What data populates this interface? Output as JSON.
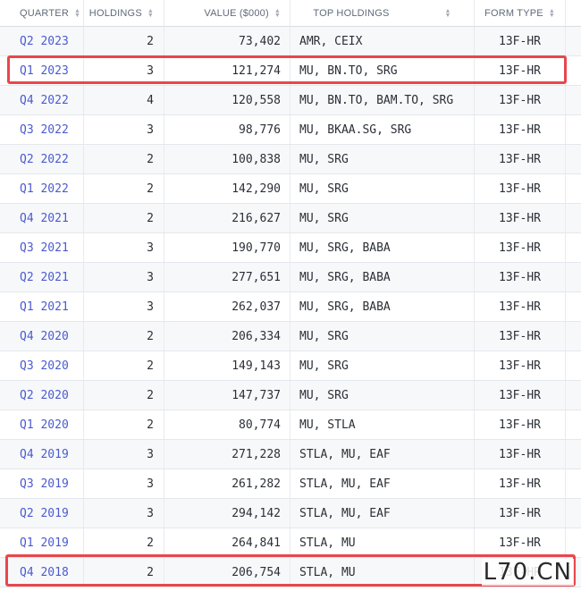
{
  "headers": {
    "quarter": "QUARTER",
    "holdings": "HOLDINGS",
    "value": "VALUE ($000)",
    "top_holdings": "TOP HOLDINGS",
    "form_type": "FORM TYPE"
  },
  "rows": [
    {
      "quarter": "Q2 2023",
      "holdings": "2",
      "value": "73,402",
      "top": "AMR, CEIX",
      "form": "13F-HR"
    },
    {
      "quarter": "Q1 2023",
      "holdings": "3",
      "value": "121,274",
      "top": "MU, BN.TO, SRG",
      "form": "13F-HR"
    },
    {
      "quarter": "Q4 2022",
      "holdings": "4",
      "value": "120,558",
      "top": "MU, BN.TO, BAM.TO, SRG",
      "form": "13F-HR"
    },
    {
      "quarter": "Q3 2022",
      "holdings": "3",
      "value": "98,776",
      "top": "MU, BKAA.SG, SRG",
      "form": "13F-HR"
    },
    {
      "quarter": "Q2 2022",
      "holdings": "2",
      "value": "100,838",
      "top": "MU, SRG",
      "form": "13F-HR"
    },
    {
      "quarter": "Q1 2022",
      "holdings": "2",
      "value": "142,290",
      "top": "MU, SRG",
      "form": "13F-HR"
    },
    {
      "quarter": "Q4 2021",
      "holdings": "2",
      "value": "216,627",
      "top": "MU, SRG",
      "form": "13F-HR"
    },
    {
      "quarter": "Q3 2021",
      "holdings": "3",
      "value": "190,770",
      "top": "MU, SRG, BABA",
      "form": "13F-HR"
    },
    {
      "quarter": "Q2 2021",
      "holdings": "3",
      "value": "277,651",
      "top": "MU, SRG, BABA",
      "form": "13F-HR"
    },
    {
      "quarter": "Q1 2021",
      "holdings": "3",
      "value": "262,037",
      "top": "MU, SRG, BABA",
      "form": "13F-HR"
    },
    {
      "quarter": "Q4 2020",
      "holdings": "2",
      "value": "206,334",
      "top": "MU, SRG",
      "form": "13F-HR"
    },
    {
      "quarter": "Q3 2020",
      "holdings": "2",
      "value": "149,143",
      "top": "MU, SRG",
      "form": "13F-HR"
    },
    {
      "quarter": "Q2 2020",
      "holdings": "2",
      "value": "147,737",
      "top": "MU, SRG",
      "form": "13F-HR"
    },
    {
      "quarter": "Q1 2020",
      "holdings": "2",
      "value": "80,774",
      "top": "MU, STLA",
      "form": "13F-HR"
    },
    {
      "quarter": "Q4 2019",
      "holdings": "3",
      "value": "271,228",
      "top": "STLA, MU, EAF",
      "form": "13F-HR"
    },
    {
      "quarter": "Q3 2019",
      "holdings": "3",
      "value": "261,282",
      "top": "STLA, MU, EAF",
      "form": "13F-HR"
    },
    {
      "quarter": "Q2 2019",
      "holdings": "3",
      "value": "294,142",
      "top": "STLA, MU, EAF",
      "form": "13F-HR"
    },
    {
      "quarter": "Q1 2019",
      "holdings": "2",
      "value": "264,841",
      "top": "STLA, MU",
      "form": "13F-HR"
    },
    {
      "quarter": "Q4 2018",
      "holdings": "2",
      "value": "206,754",
      "top": "STLA, MU",
      "form": "13F-HR"
    }
  ],
  "watermark": "L70.CN",
  "colors": {
    "link": "#4b5bd0",
    "highlight": "#e8474b"
  }
}
